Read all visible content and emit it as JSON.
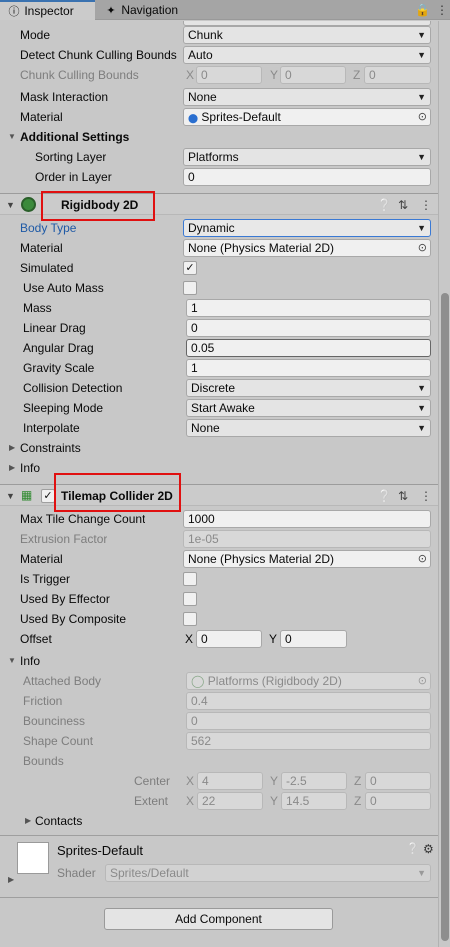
{
  "tabs": [
    {
      "label": "Inspector",
      "icon": "info-icon"
    },
    {
      "label": "Navigation",
      "icon": "navigation-icon"
    }
  ],
  "tilemap_renderer": {
    "mode": {
      "label": "Mode",
      "value": "Chunk"
    },
    "detect_culling": {
      "label": "Detect Chunk Culling Bounds",
      "value": "Auto"
    },
    "culling_bounds": {
      "label": "Chunk Culling Bounds",
      "x": "0",
      "y": "0",
      "z": "0"
    },
    "mask_interaction": {
      "label": "Mask Interaction",
      "value": "None"
    },
    "material": {
      "label": "Material",
      "value": "Sprites-Default"
    },
    "additional_settings": "Additional Settings",
    "sorting_layer": {
      "label": "Sorting Layer",
      "value": "Platforms"
    },
    "order_in_layer": {
      "label": "Order in Layer",
      "value": "0"
    }
  },
  "rigidbody": {
    "title": "Rigidbody 2D",
    "body_type": {
      "label": "Body Type",
      "value": "Dynamic"
    },
    "material": {
      "label": "Material",
      "value": "None (Physics Material 2D)"
    },
    "simulated": {
      "label": "Simulated",
      "checked": true
    },
    "use_auto_mass": {
      "label": "Use Auto Mass",
      "checked": false
    },
    "mass": {
      "label": "Mass",
      "value": "1"
    },
    "linear_drag": {
      "label": "Linear Drag",
      "value": "0"
    },
    "angular_drag": {
      "label": "Angular Drag",
      "value": "0.05"
    },
    "gravity_scale": {
      "label": "Gravity Scale",
      "value": "1"
    },
    "collision_detection": {
      "label": "Collision Detection",
      "value": "Discrete"
    },
    "sleeping_mode": {
      "label": "Sleeping Mode",
      "value": "Start Awake"
    },
    "interpolate": {
      "label": "Interpolate",
      "value": "None"
    },
    "constraints": "Constraints",
    "info": "Info"
  },
  "tilemap_collider": {
    "title": "Tilemap Collider 2D",
    "enabled": true,
    "max_tile_change": {
      "label": "Max Tile Change Count",
      "value": "1000"
    },
    "extrusion_factor": {
      "label": "Extrusion Factor",
      "value": "1e-05"
    },
    "material": {
      "label": "Material",
      "value": "None (Physics Material 2D)"
    },
    "is_trigger": {
      "label": "Is Trigger",
      "checked": false
    },
    "used_by_effector": {
      "label": "Used By Effector",
      "checked": false
    },
    "used_by_composite": {
      "label": "Used By Composite",
      "checked": false
    },
    "offset": {
      "label": "Offset",
      "x": "0",
      "y": "0"
    },
    "info": "Info",
    "attached_body": {
      "label": "Attached Body",
      "value": "Platforms (Rigidbody 2D)"
    },
    "friction": {
      "label": "Friction",
      "value": "0.4"
    },
    "bounciness": {
      "label": "Bounciness",
      "value": "0"
    },
    "shape_count": {
      "label": "Shape Count",
      "value": "562"
    },
    "bounds": {
      "label": "Bounds",
      "center": {
        "label": "Center",
        "x": "4",
        "y": "-2.5",
        "z": "0"
      },
      "extent": {
        "label": "Extent",
        "x": "22",
        "y": "14.5",
        "z": "0"
      }
    },
    "contacts": "Contacts"
  },
  "material_panel": {
    "name": "Sprites-Default",
    "shader_label": "Shader",
    "shader_value": "Sprites/Default"
  },
  "axis": {
    "x": "X",
    "y": "Y",
    "z": "Z"
  },
  "add_component": "Add Component",
  "colors": {
    "accent": "#3a72b0",
    "highlight": "#e01010",
    "label_blue": "#1f5aa6"
  }
}
